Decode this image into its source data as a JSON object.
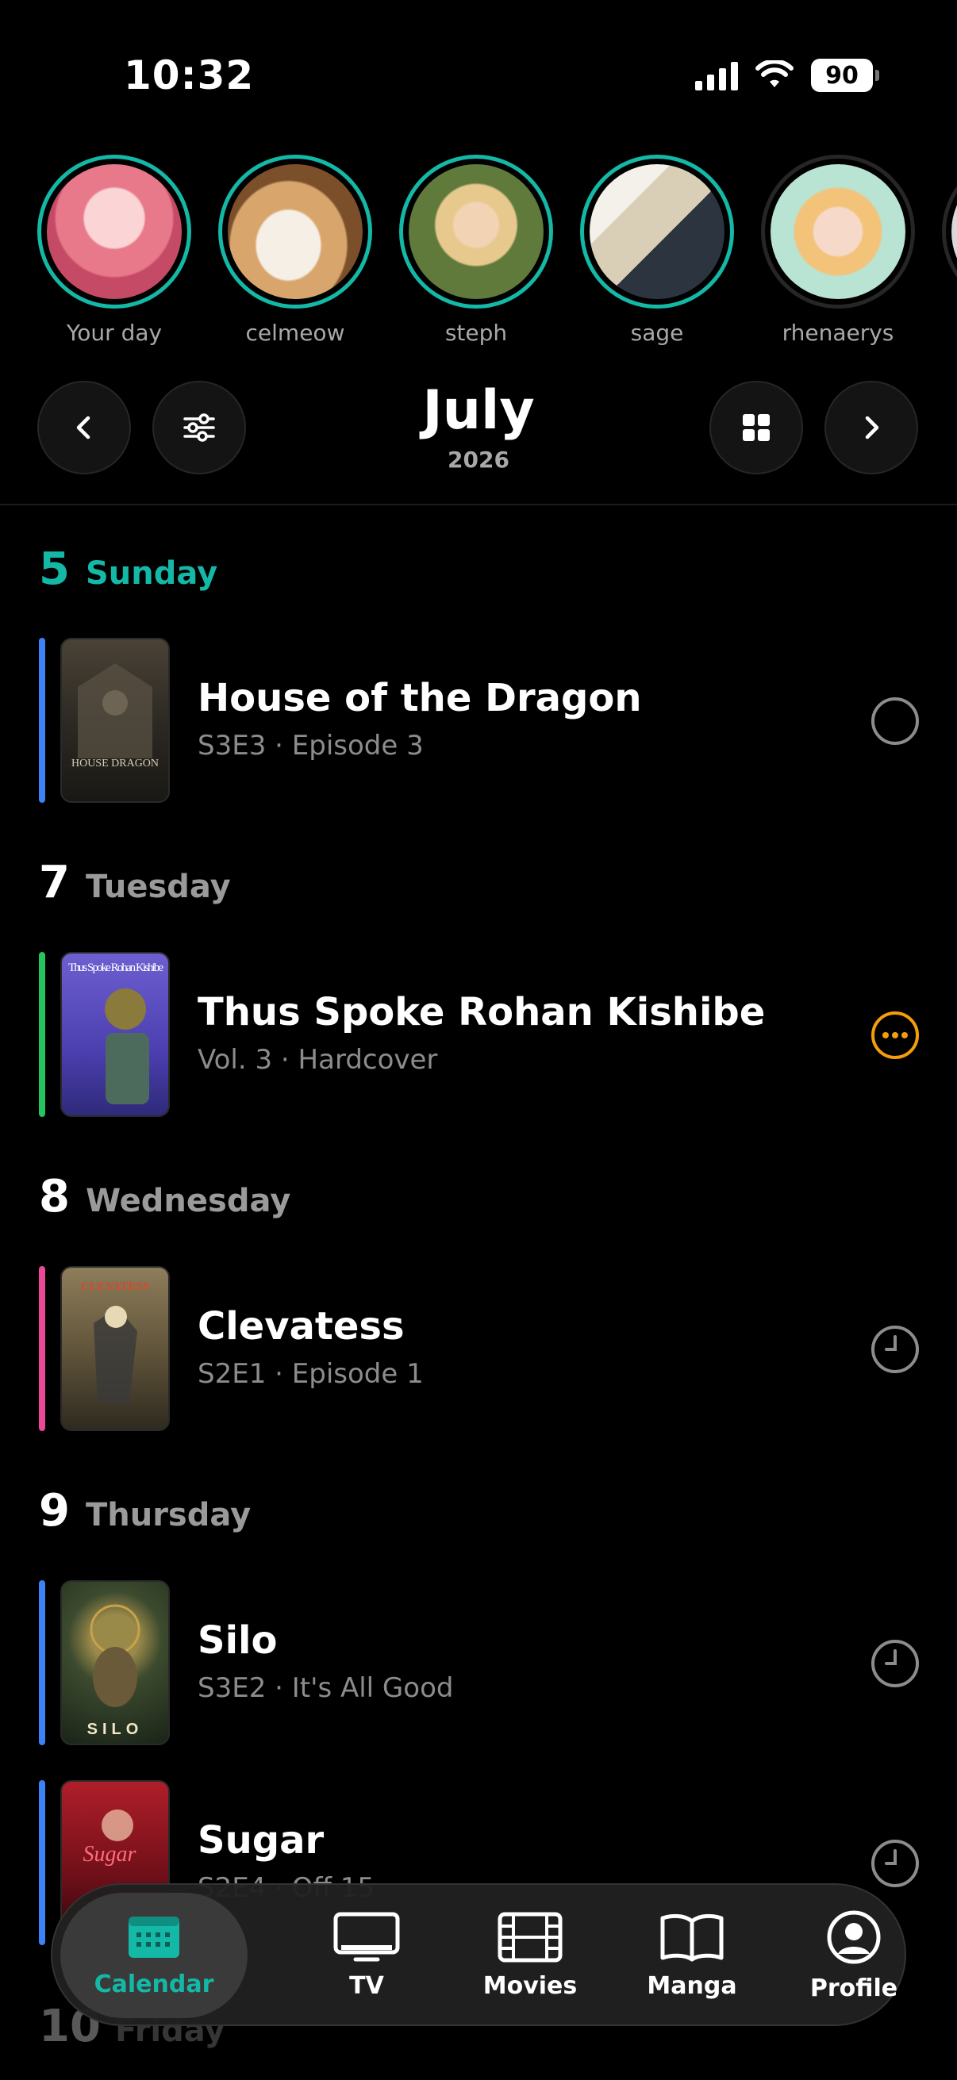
{
  "status_bar": {
    "time": "10:32",
    "battery": "90"
  },
  "stories": [
    {
      "name": "Your day"
    },
    {
      "name": "celmeow"
    },
    {
      "name": "steph"
    },
    {
      "name": "sage"
    },
    {
      "name": "rhenaerys"
    }
  ],
  "header": {
    "month": "July",
    "year": "2026"
  },
  "colors": {
    "accent": "#14b8a6",
    "tv": "#3b82f6",
    "manga": "#22c55e",
    "anime": "#ec4899",
    "pending": "#f59e0b"
  },
  "days": [
    {
      "num": "5",
      "name": "Sunday"
    },
    {
      "num": "7",
      "name": "Tuesday"
    },
    {
      "num": "8",
      "name": "Wednesday"
    },
    {
      "num": "9",
      "name": "Thursday"
    },
    {
      "num": "10",
      "name": "Friday"
    }
  ],
  "items": [
    {
      "title": "House of the Dragon",
      "subtitle": "S3E3 · Episode 3",
      "poster_text": "HOUSE DRAGON",
      "status": "circle-icon"
    },
    {
      "title": "Thus Spoke Rohan Kishibe",
      "subtitle": "Vol. 3 · Hardcover",
      "poster_text": "Thus Spoke Rohan Kishibe",
      "status": "more-icon"
    },
    {
      "title": "Clevatess",
      "subtitle": "S2E1 · Episode 1",
      "poster_text": "CLEVATESS",
      "status": "clock-icon"
    },
    {
      "title": "Silo",
      "subtitle": "S3E2 · It's All Good",
      "poster_text": "SILO",
      "status": "clock-icon"
    },
    {
      "title": "Sugar",
      "subtitle": "S2E4 · Off 15",
      "poster_text": "Sugar",
      "status": "clock-icon"
    }
  ],
  "tabs": [
    {
      "label": "Calendar",
      "icon": "calendar-icon"
    },
    {
      "label": "TV",
      "icon": "tv-icon"
    },
    {
      "label": "Movies",
      "icon": "film-icon"
    },
    {
      "label": "Manga",
      "icon": "book-icon"
    },
    {
      "label": "Profile",
      "icon": "profile-icon"
    }
  ]
}
